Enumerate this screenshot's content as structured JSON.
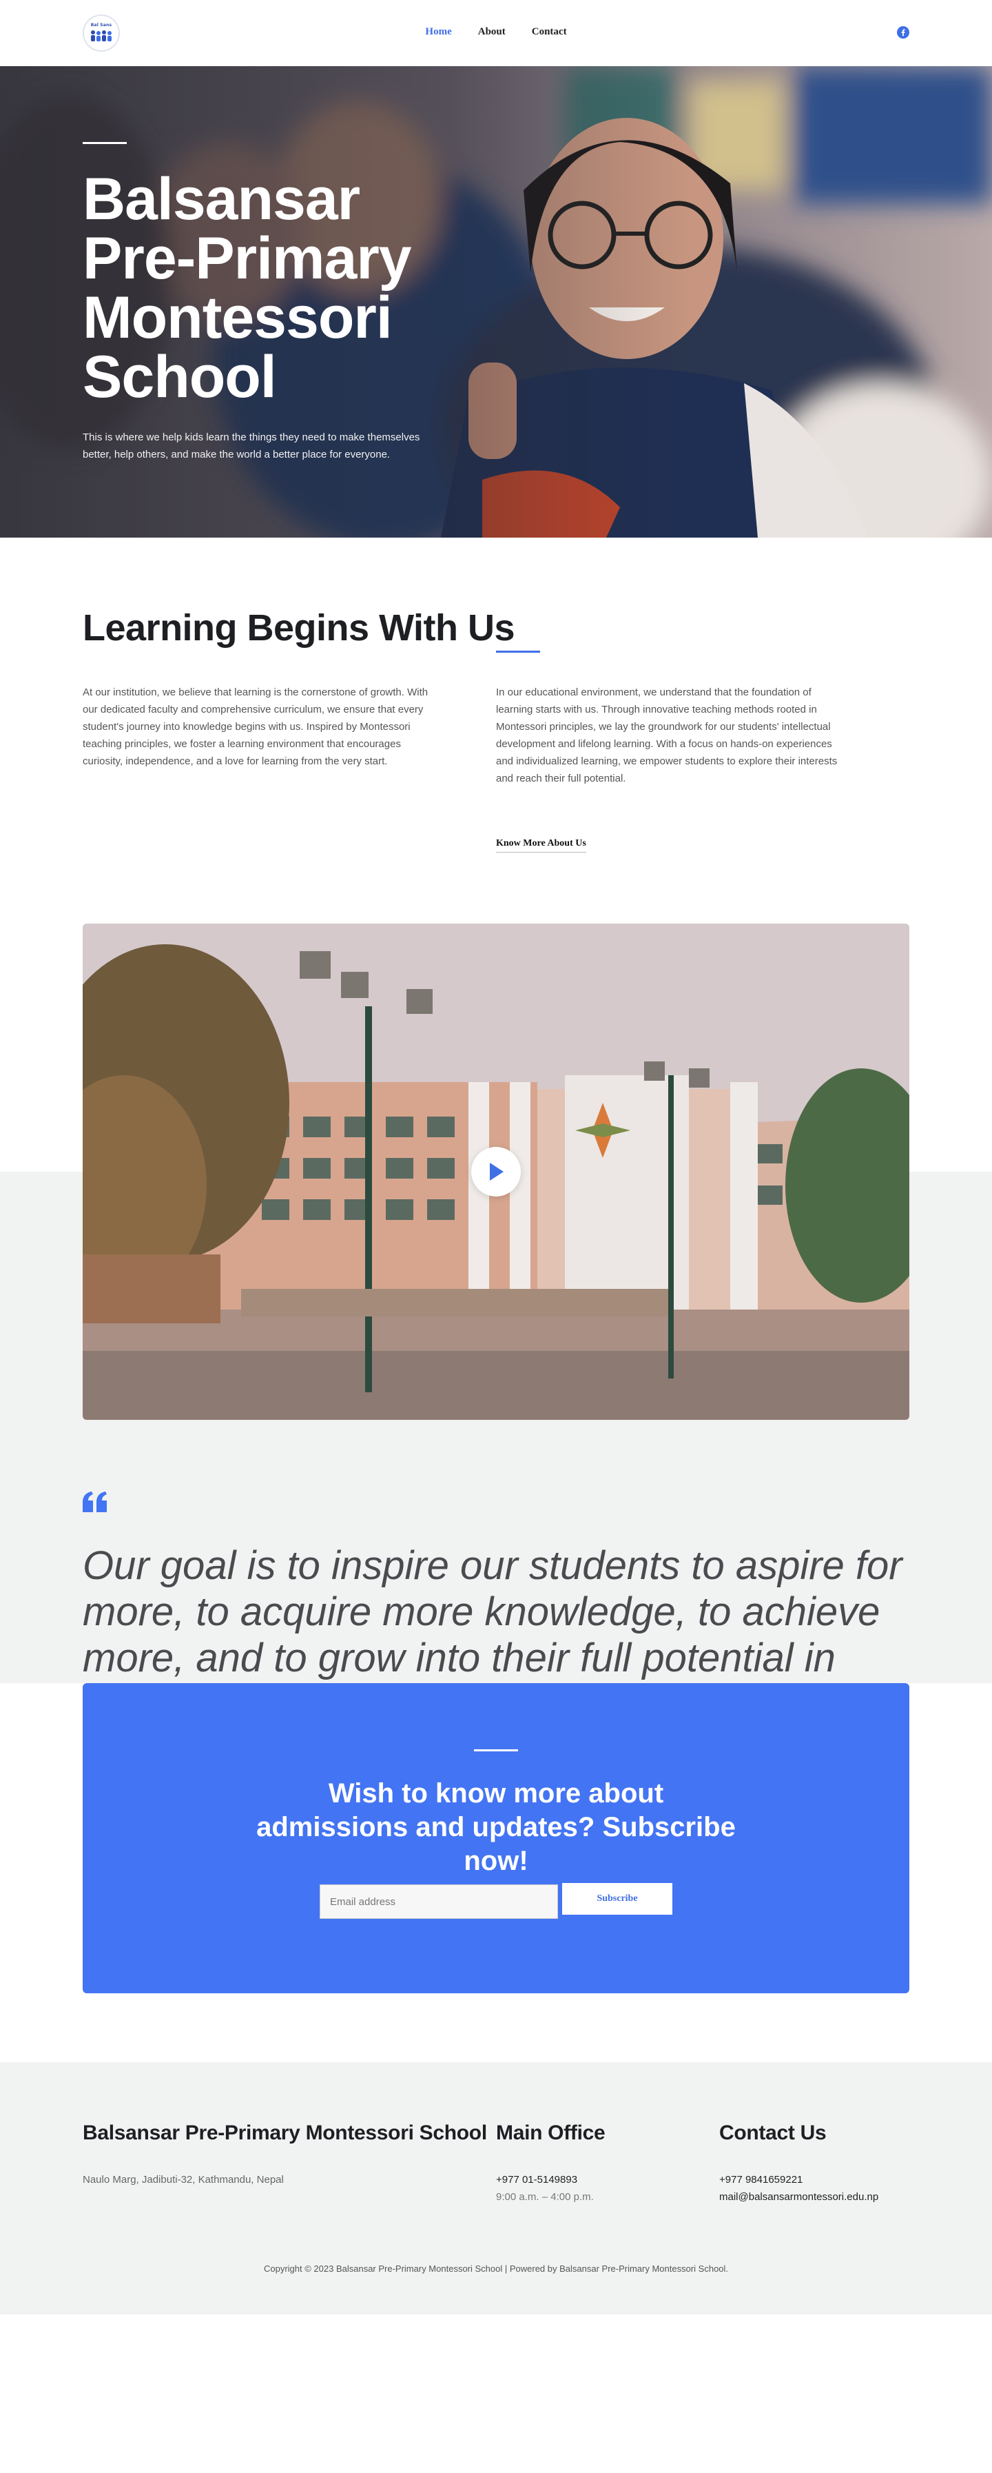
{
  "header": {
    "logo_text": "Bal Sans",
    "nav": [
      {
        "label": "Home",
        "active": true
      },
      {
        "label": "About",
        "active": false
      },
      {
        "label": "Contact",
        "active": false
      }
    ],
    "social_icon": "facebook-icon"
  },
  "hero": {
    "title": "Balsansar Pre-Primary Montessori School",
    "text": "This is where we help kids learn the things they need to make themselves better, help others, and make the world a better place for everyone."
  },
  "about": {
    "heading": "Learning Begins With Us",
    "col1": "At our institution, we believe that learning is the cornerstone of growth. With our dedicated faculty and comprehensive curriculum, we ensure that every student's journey into knowledge begins with us. Inspired by Montessori teaching principles, we foster a learning environment that encourages curiosity, independence, and a love for learning from the very start.",
    "col2": "In our educational environment, we understand that the foundation of learning starts with us. Through innovative teaching methods rooted in Montessori principles, we lay the groundwork for our students' intellectual development and lifelong learning. With a focus on hands-on experiences and individualized learning, we empower students to explore their interests and reach their full potential.",
    "link": "Know More About Us"
  },
  "quote": {
    "icon": "quote-icon",
    "text": "Our goal is to inspire our students to aspire for more, to acquire more knowledge, to achieve more, and to grow into their full potential in their individual life journeys."
  },
  "subscribe": {
    "heading": "Wish to know more about admissions and updates? Subscribe now!",
    "placeholder": "Email address",
    "button": "Subscribe"
  },
  "footer": {
    "school_name": "Balsansar Pre-Primary Montessori School",
    "address": "Naulo Marg, Jadibuti-32, Kathmandu, Nepal",
    "office_title": "Main Office",
    "office_phone": "+977 01-5149893",
    "office_hours": "9:00 a.m. – 4:00 p.m.",
    "contact_title": "Contact Us",
    "contact_phone": "+977 9841659221",
    "contact_email": "mail@balsansarmontessori.edu.np",
    "copyright": "Copyright © 2023 Balsansar Pre-Primary Montessori School | Powered by Balsansar Pre-Primary Montessori School."
  },
  "colors": {
    "accent": "#4374f3",
    "light_bg": "#f1f2f2"
  }
}
